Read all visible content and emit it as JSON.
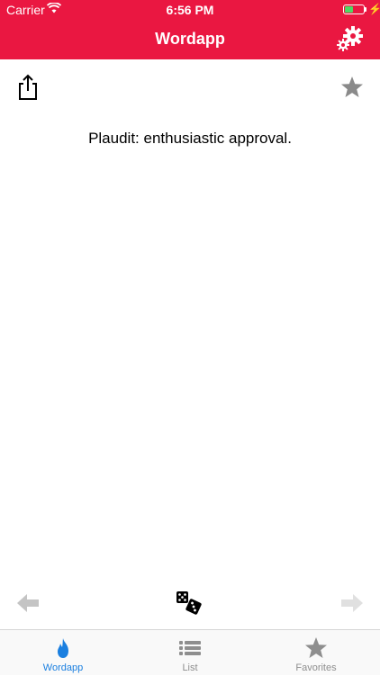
{
  "status_bar": {
    "carrier": "Carrier",
    "time": "6:56 PM",
    "battery_level_percent": 45
  },
  "header": {
    "title": "Wordapp",
    "background_color": "#ea1741"
  },
  "toolbar": {
    "share_icon": "share-icon",
    "favorite_icon": "star-icon"
  },
  "word": {
    "definition": "Plaudit: enthusiastic approval."
  },
  "controls": {
    "prev_icon": "arrow-left-icon",
    "random_icon": "dice-icon",
    "next_icon": "arrow-right-icon"
  },
  "tabs": [
    {
      "label": "Wordapp",
      "icon": "flame-icon",
      "active": true
    },
    {
      "label": "List",
      "icon": "list-icon",
      "active": false
    },
    {
      "label": "Favorites",
      "icon": "star-icon",
      "active": false
    }
  ],
  "colors": {
    "active_tab": "#1a7fe0",
    "inactive_tab": "#8e8e8e"
  }
}
